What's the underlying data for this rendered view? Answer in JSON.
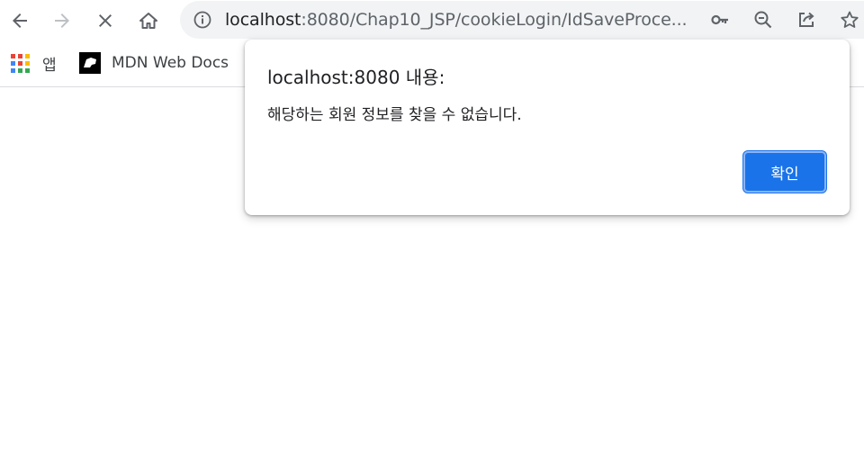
{
  "browser": {
    "url_host": "localhost",
    "url_rest": ":8080/Chap10_JSP/cookieLogin/IdSaveProce...",
    "icons": {
      "back": "arrow-left-icon",
      "forward": "arrow-right-icon",
      "stop": "close-x-icon",
      "home": "home-icon",
      "site_info": "info-circle-icon",
      "passwords": "key-icon",
      "zoom": "zoom-out-icon",
      "share": "share-icon",
      "bookmark": "star-icon"
    }
  },
  "bookmarks_bar": {
    "items": [
      {
        "label": "앱",
        "icon": "apps-grid-icon"
      },
      {
        "label": "MDN Web Docs",
        "icon": "mdn-logo-icon"
      }
    ]
  },
  "alert_dialog": {
    "title": "localhost:8080 내용:",
    "message": "해당하는 회원 정보를 찾을 수 없습니다.",
    "ok_label": "확인",
    "accent_color": "#1a73e8"
  }
}
